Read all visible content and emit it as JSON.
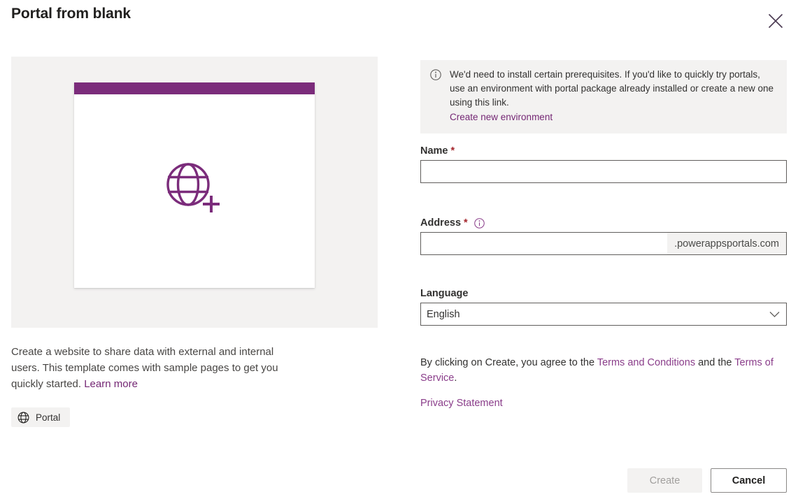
{
  "dialog": {
    "title": "Portal from blank",
    "close_icon": "close-icon"
  },
  "preview": {
    "icon": "globe-plus-icon",
    "accent_color": "#7b2c7b",
    "panel_bg": "#f3f2f1",
    "description_part1": "Create a website to share data with external and internal users. This template comes with sample pages to get you quickly started. ",
    "learn_more_label": "Learn more",
    "tag": {
      "icon": "globe-icon",
      "label": "Portal"
    }
  },
  "banner": {
    "icon": "info-icon",
    "message": "We'd need to install certain prerequisites. If you'd like to quickly try portals, use an environment with portal package already installed or create a new one using this link.",
    "link_label": "Create new environment"
  },
  "form": {
    "name": {
      "label": "Name",
      "required_marker": "*",
      "value": "",
      "placeholder": ""
    },
    "address": {
      "label": "Address",
      "required_marker": "*",
      "info_icon": "info-icon",
      "value": "",
      "placeholder": "",
      "suffix": ".powerappsportals.com"
    },
    "language": {
      "label": "Language",
      "selected": "English",
      "chevron_icon": "chevron-down-icon"
    }
  },
  "legal": {
    "text_before": "By clicking on Create, you agree to the ",
    "terms_and_conditions": "Terms and Conditions",
    "text_middle": " and the ",
    "terms_of_service": "Terms of Service",
    "text_after": ".",
    "privacy_statement": "Privacy Statement"
  },
  "footer": {
    "create_label": "Create",
    "cancel_label": "Cancel"
  },
  "colors": {
    "brand_purple": "#742774",
    "link_purple": "#8a3d8a",
    "required_red": "#a4262c",
    "neutral_light": "#f3f2f1"
  }
}
